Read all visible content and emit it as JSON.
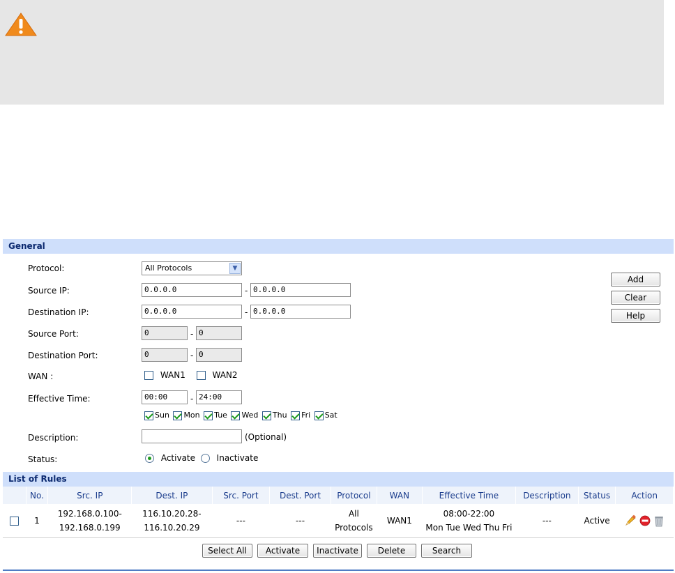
{
  "general": {
    "header": "General",
    "protocol": {
      "label": "Protocol:",
      "value": "All Protocols"
    },
    "source_ip": {
      "label": "Source IP:",
      "from": "0.0.0.0",
      "to": "0.0.0.0"
    },
    "destination_ip": {
      "label": "Destination IP:",
      "from": "0.0.0.0",
      "to": "0.0.0.0"
    },
    "source_port": {
      "label": "Source Port:",
      "from": "0",
      "to": "0"
    },
    "destination_port": {
      "label": "Destination Port:",
      "from": "0",
      "to": "0"
    },
    "wan": {
      "label": "WAN :",
      "options": [
        "WAN1",
        "WAN2"
      ]
    },
    "effective_time": {
      "label": "Effective Time:",
      "from": "00:00",
      "to": "24:00"
    },
    "days": [
      "Sun",
      "Mon",
      "Tue",
      "Wed",
      "Thu",
      "Fri",
      "Sat"
    ],
    "description": {
      "label": "Description:",
      "value": "",
      "hint": "(Optional)"
    },
    "status": {
      "label": "Status:",
      "activate": "Activate",
      "inactivate": "Inactivate"
    },
    "dash": "-"
  },
  "side_buttons": {
    "add": "Add",
    "clear": "Clear",
    "help": "Help"
  },
  "list": {
    "header": "List of Rules",
    "columns": [
      "No.",
      "Src. IP",
      "Dest. IP",
      "Src. Port",
      "Dest. Port",
      "Protocol",
      "WAN",
      "Effective Time",
      "Description",
      "Status",
      "Action"
    ],
    "rows": [
      {
        "no": "1",
        "src_ip_1": "192.168.0.100-",
        "src_ip_2": "192.168.0.199",
        "dest_ip_1": "116.10.20.28-",
        "dest_ip_2": "116.10.20.29",
        "src_port": "---",
        "dest_port": "---",
        "protocol_1": "All",
        "protocol_2": "Protocols",
        "wan": "WAN1",
        "time_1": "08:00-22:00",
        "time_2": "Mon Tue Wed Thu Fri",
        "description": "---",
        "status": "Active"
      }
    ]
  },
  "bottom_buttons": {
    "select_all": "Select All",
    "activate": "Activate",
    "inactivate": "Inactivate",
    "delete": "Delete",
    "search": "Search"
  },
  "icons": {
    "warning": "warning-icon",
    "edit": "pencil-icon",
    "disable": "stop-icon",
    "delete": "trash-icon"
  },
  "colors": {
    "section_header_bg": "#cfdffb",
    "section_header_text": "#0c2a70",
    "notice_bg": "#e6e6e6",
    "check_green": "#1c9a1c"
  }
}
